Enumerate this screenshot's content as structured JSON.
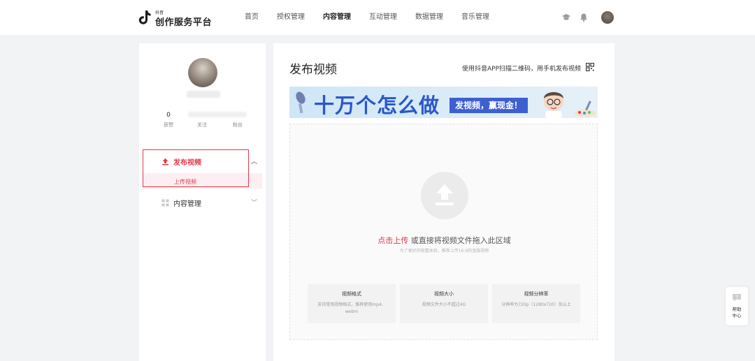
{
  "header": {
    "logo_small": "抖音",
    "logo_text": "创作服务平台",
    "nav": [
      "首页",
      "授权管理",
      "内容管理",
      "互动管理",
      "数据管理",
      "音乐管理"
    ],
    "nav_active": "内容管理",
    "icons": [
      "graduation-cap-icon",
      "bell-icon"
    ]
  },
  "sidebar": {
    "stats": {
      "likes_value": "0",
      "likes_label": "获赞",
      "following_label": "关注",
      "fans_label": "粉丝"
    },
    "menu": {
      "publish_label": "发布视频",
      "upload_label": "上传视频",
      "content_label": "内容管理"
    }
  },
  "main": {
    "title": "发布视频",
    "scan_hint": "使用抖音APP扫描二维码，用手机发布视频",
    "banner": {
      "title": "十万个怎么做",
      "pill": "发视频，赢现金！"
    },
    "upload": {
      "link_text": "点击上传",
      "rest_text": " 或直接将视频文件拖入此区域",
      "sub_text": "为了更好的观看体验，推荐上传16:9的竖版视频"
    },
    "cards": [
      {
        "title": "视频格式",
        "desc": "支持常用视频格式，推荐使用mp4、webm"
      },
      {
        "title": "视频大小",
        "desc": "视频文件大小不超过4G"
      },
      {
        "title": "视频分辨率",
        "desc": "分辨率为720p（1280x720）及以上"
      }
    ]
  },
  "help": {
    "label_line1": "帮助",
    "label_line2": "中心"
  },
  "colors": {
    "accent": "#e0384a",
    "banner_blue": "#2b57c9",
    "background": "#f2f3f5"
  }
}
